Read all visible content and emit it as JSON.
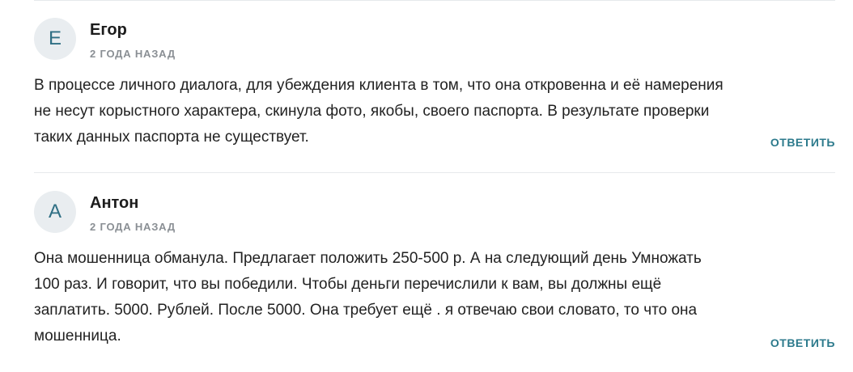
{
  "comments": [
    {
      "avatar_letter": "Е",
      "author": "Егор",
      "date": "2 ГОДА НАЗАД",
      "text": "В процессе личного диалога, для убеждения клиента в том, что она откровенна и её намерения не несут корыстного характера, скинула фото, якобы, своего паспорта. В результате проверки таких данных паспорта не существует.",
      "reply_label": "ОТВЕТИТЬ"
    },
    {
      "avatar_letter": "А",
      "author": "Антон",
      "date": "2 ГОДА НАЗАД",
      "text": "Она мошенница обманула. Предлагает положить 250-500 р. А на следующий день Умножать 100 раз. И говорит, что вы победили. Чтобы деньги перечислили к вам, вы должны ещё заплатить. 5000. Рублей. После 5000. Она требует ещё . я отвечаю свои словато, то что она мошенница.",
      "reply_label": "ОТВЕТИТЬ"
    }
  ],
  "colors": {
    "accent": "#2c7a8c",
    "avatar_bg": "#e9edf0",
    "meta": "#8a8f94"
  }
}
